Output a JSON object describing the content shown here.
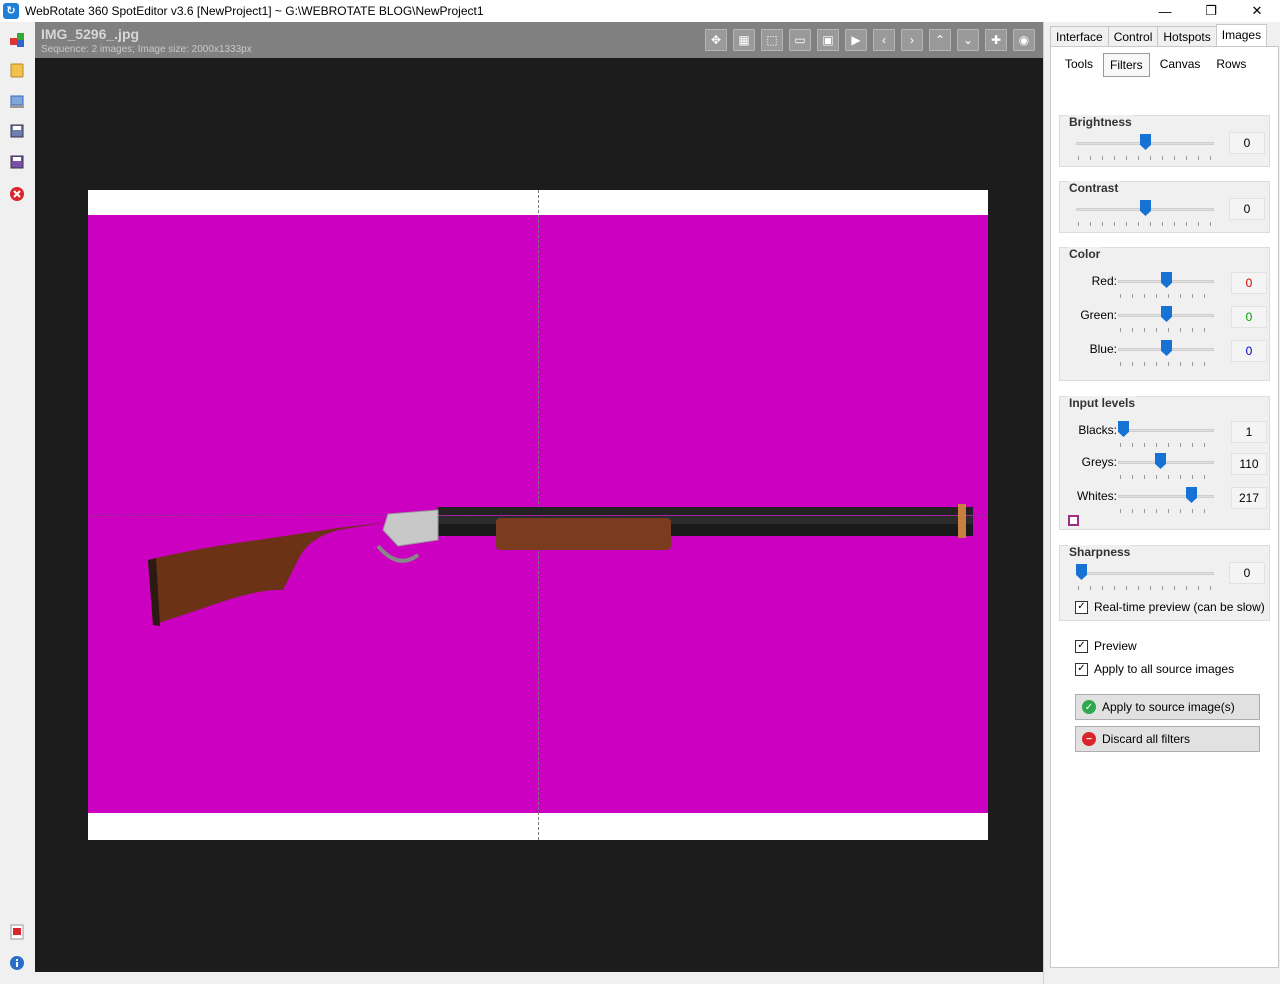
{
  "window": {
    "title": "WebRotate 360 SpotEditor v3.6 [NewProject1] ~ G:\\WEBROTATE BLOG\\NewProject1",
    "minimize": "—",
    "restore": "❐",
    "close": "✕"
  },
  "editor": {
    "image_name": "IMG_5296_.jpg",
    "image_info": "Sequence: 2 images; Image size: 2000x1333px",
    "canvas_color": "#cc00c0"
  },
  "main_tabs": [
    "Interface",
    "Control",
    "Hotspots",
    "Images"
  ],
  "sub_tabs": [
    "Tools",
    "Filters",
    "Canvas",
    "Rows"
  ],
  "filters": {
    "brightness": {
      "title": "Brightness",
      "value": "0",
      "level": 0.5
    },
    "contrast": {
      "title": "Contrast",
      "value": "0",
      "level": 0.5
    },
    "color": {
      "title": "Color",
      "red": {
        "label": "Red:",
        "value": "0",
        "level": 0.5,
        "color": "#d00000"
      },
      "green": {
        "label": "Green:",
        "value": "0",
        "level": 0.5,
        "color": "#00a000"
      },
      "blue": {
        "label": "Blue:",
        "value": "0",
        "level": 0.5,
        "color": "#0000d0"
      }
    },
    "input_levels": {
      "title": "Input levels",
      "blacks": {
        "label": "Blacks:",
        "value": "1",
        "level": 0.0
      },
      "greys": {
        "label": "Greys:",
        "value": "110",
        "level": 0.44
      },
      "whites": {
        "label": "Whites:",
        "value": "217",
        "level": 0.8
      }
    },
    "sharpness": {
      "title": "Sharpness",
      "value": "0",
      "level": 0.0
    },
    "realtime_preview": "Real-time preview (can be slow)",
    "preview": "Preview",
    "apply_all": "Apply to all source images",
    "apply_button": "Apply to source image(s)",
    "discard_button": "Discard all filters"
  }
}
